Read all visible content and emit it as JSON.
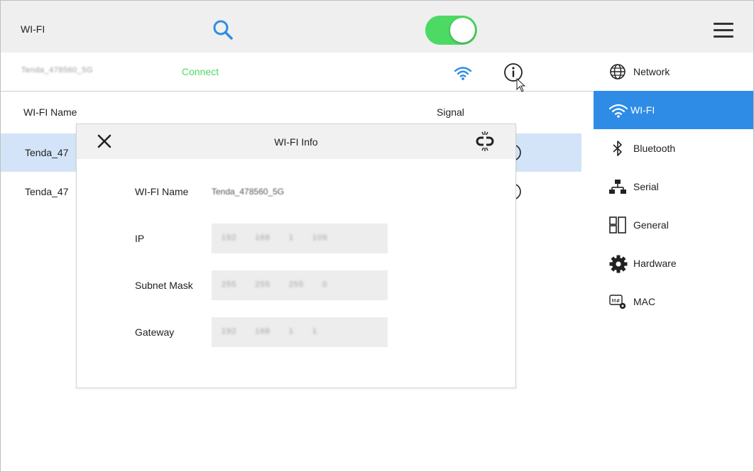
{
  "header": {
    "title": "WI-FI",
    "search_icon": "search-icon",
    "wifi_enabled": true,
    "toggle_color": "#4cd964",
    "menu_icon": "hamburger-menu-icon"
  },
  "connected": {
    "name": "Tenda_478560_5G",
    "status": "Connect",
    "status_color": "#4cd964",
    "signal_icon": "wifi-signal-icon",
    "signal_color": "#2e8ce6",
    "info_icon": "info-icon"
  },
  "table": {
    "columns": [
      "WI-FI Name",
      "Signal"
    ],
    "rows": [
      {
        "name": "Tenda_47",
        "selected": true
      },
      {
        "name": "Tenda_47",
        "selected": false
      }
    ]
  },
  "sidebar": {
    "accent": "#2e8ce6",
    "items": [
      {
        "label": "Network",
        "icon": "globe-icon",
        "active": false
      },
      {
        "label": "WI-FI",
        "icon": "wifi-icon",
        "active": true
      },
      {
        "label": "Bluetooth",
        "icon": "bluetooth-icon",
        "active": false
      },
      {
        "label": "Serial",
        "icon": "serial-network-icon",
        "active": false
      },
      {
        "label": "General",
        "icon": "layout-grid-icon",
        "active": false
      },
      {
        "label": "Hardware",
        "icon": "gear-icon",
        "active": false
      },
      {
        "label": "MAC",
        "icon": "mac-settings-icon",
        "active": false
      }
    ]
  },
  "dialog": {
    "title": "WI-FI Info",
    "close_icon": "close-icon",
    "disconnect_icon": "unlink-icon",
    "fields": {
      "name": {
        "label": "WI-FI Name",
        "value": "Tenda_478560_5G"
      },
      "ip": {
        "label": "IP",
        "value": "192 168 1 109"
      },
      "subnet": {
        "label": "Subnet Mask",
        "value": "255 255 255 0"
      },
      "gateway": {
        "label": "Gateway",
        "value": "192 168 1 1"
      }
    }
  }
}
